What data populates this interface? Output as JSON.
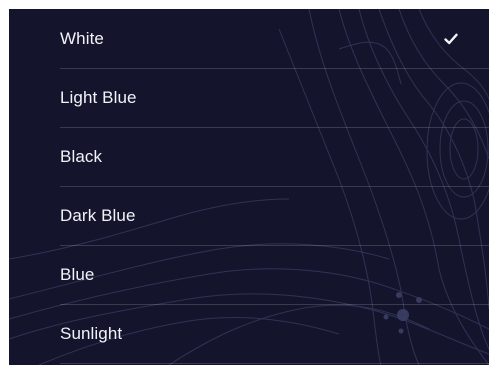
{
  "color_menu": {
    "items": [
      {
        "label": "White",
        "selected": true
      },
      {
        "label": "Light Blue",
        "selected": false
      },
      {
        "label": "Black",
        "selected": false
      },
      {
        "label": "Dark Blue",
        "selected": false
      },
      {
        "label": "Blue",
        "selected": false
      },
      {
        "label": "Sunlight",
        "selected": false
      }
    ],
    "selected_icon": "checkmark-icon"
  },
  "colors": {
    "background": "#14152c",
    "text": "#f2f3f8",
    "divider": "rgba(255,255,255,0.16)",
    "topo_lines": "#3a3c63"
  }
}
